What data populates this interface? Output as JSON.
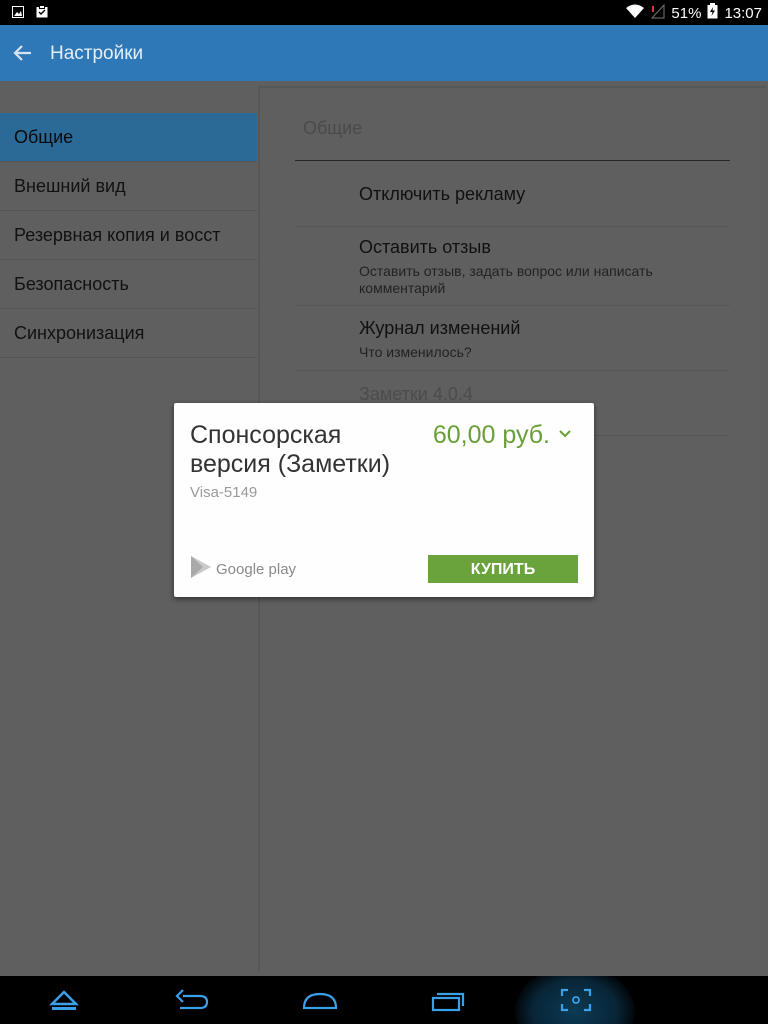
{
  "status_bar": {
    "battery_percent": "51%",
    "time": "13:07"
  },
  "action_bar": {
    "title": "Настройки"
  },
  "sidebar": {
    "items": [
      {
        "label": "Общие",
        "active": true
      },
      {
        "label": "Внешний вид",
        "active": false
      },
      {
        "label": "Резервная копия и восст",
        "active": false
      },
      {
        "label": "Безопасность",
        "active": false
      },
      {
        "label": "Синхронизация",
        "active": false
      }
    ]
  },
  "panel": {
    "section_title": "Общие",
    "prefs": [
      {
        "title": "Отключить рекламу",
        "summary": ""
      },
      {
        "title": "Оставить отзыв",
        "summary": "Оставить отзыв, задать вопрос или написать комментарий"
      },
      {
        "title": "Журнал изменений",
        "summary": "Что изменилось?"
      },
      {
        "title": "Заметки 4.0.4",
        "summary": ""
      }
    ]
  },
  "dialog": {
    "title": "Спонсорская версия (Заметки)",
    "price": "60,00 руб.",
    "payment_method": "Visa-5149",
    "store_label": "Google play",
    "buy_label": "КУПИТЬ",
    "accent_color": "#689f38"
  },
  "nav_bar": {
    "icons": [
      "up-icon",
      "back-icon",
      "home-icon",
      "recents-icon",
      "screenshot-icon"
    ]
  }
}
